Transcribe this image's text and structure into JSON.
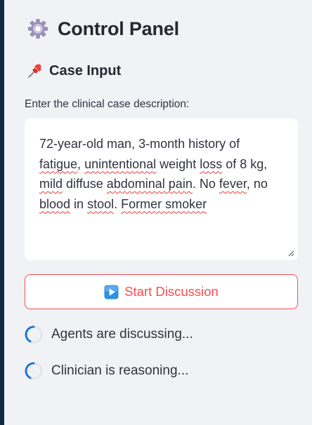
{
  "sidebar": {
    "title": "Control Panel",
    "title_icon": "gear-icon",
    "section_heading": "Case Input",
    "section_icon": "pushpin-icon",
    "textarea_label": "Enter the clinical case description:",
    "case_text": {
      "segments": [
        {
          "text": "72-year-old man, 3-month history of ",
          "misspelled": false
        },
        {
          "text": "fatigue",
          "misspelled": true
        },
        {
          "text": ", ",
          "misspelled": false
        },
        {
          "text": "unintentional",
          "misspelled": true
        },
        {
          "text": " weight ",
          "misspelled": false
        },
        {
          "text": "loss",
          "misspelled": true
        },
        {
          "text": " of 8 kg, ",
          "misspelled": false
        },
        {
          "text": "mild",
          "misspelled": true
        },
        {
          "text": " diffuse ",
          "misspelled": false
        },
        {
          "text": "abdominal pain",
          "misspelled": true
        },
        {
          "text": ". No ",
          "misspelled": false
        },
        {
          "text": "fever",
          "misspelled": true
        },
        {
          "text": ", no ",
          "misspelled": false
        },
        {
          "text": "blood",
          "misspelled": true
        },
        {
          "text": " in ",
          "misspelled": false
        },
        {
          "text": "stool",
          "misspelled": true
        },
        {
          "text": ". ",
          "misspelled": false
        },
        {
          "text": "Former smoker",
          "misspelled": true
        }
      ]
    },
    "start_button_label": "Start Discussion",
    "start_button_icon": "play-button-icon",
    "statuses": [
      {
        "label": "Agents are discussing...",
        "icon": "spinner-icon"
      },
      {
        "label": "Clinician is reasoning...",
        "icon": "spinner-icon"
      }
    ]
  },
  "colors": {
    "background": "#f0f2f6",
    "left_edge": "#0e2a47",
    "accent": "#ff4b4b",
    "spinner": "#1f77d4",
    "text": "#31333f"
  }
}
